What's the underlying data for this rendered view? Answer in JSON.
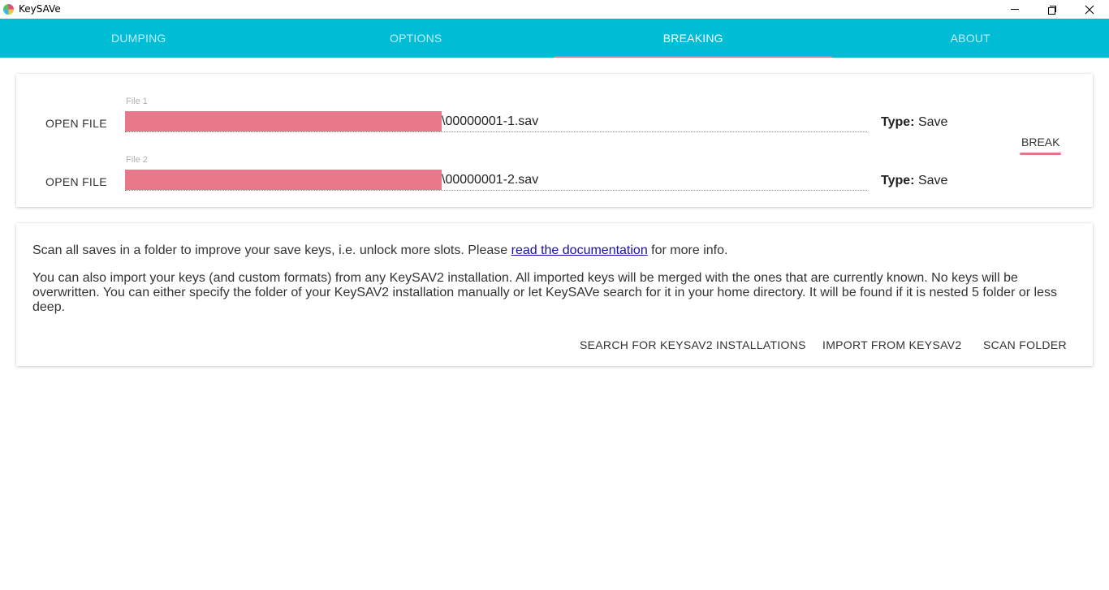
{
  "window": {
    "title": "KeySAVe"
  },
  "tabs": [
    {
      "label": "DUMPING"
    },
    {
      "label": "OPTIONS"
    },
    {
      "label": "BREAKING"
    },
    {
      "label": "ABOUT"
    }
  ],
  "active_tab": "BREAKING",
  "breaking": {
    "files": [
      {
        "label": "File 1",
        "open_label": "OPEN FILE",
        "path_suffix": "\\00000001-1.sav",
        "type_label": "Type:",
        "type_value": "Save"
      },
      {
        "label": "File 2",
        "open_label": "OPEN FILE",
        "path_suffix": "\\00000001-2.sav",
        "type_label": "Type:",
        "type_value": "Save"
      }
    ],
    "break_label": "BREAK"
  },
  "scan": {
    "para1_before": "Scan all saves in a folder to improve your save keys, i.e. unlock more slots. Please ",
    "para1_link": "read the documentation",
    "para1_after": " for more info.",
    "para2": "You can also import your keys (and custom formats) from any KeySAV2 installation. All imported keys will be merged with the ones that are currently known. No keys will be overwritten. You can either specify the folder of your KeySAV2 installation manually or let KeySAVe search for it in your home directory. It will be found if it is nested 5 folder or less deep.",
    "buttons": {
      "search": "SEARCH FOR KEYSAV2 INSTALLATIONS",
      "import": "IMPORT FROM KEYSAV2",
      "scan": "SCAN FOLDER"
    }
  },
  "colors": {
    "accent": "#00bcd4",
    "indicator": "#e7758a",
    "redaction": "#e8788a"
  }
}
